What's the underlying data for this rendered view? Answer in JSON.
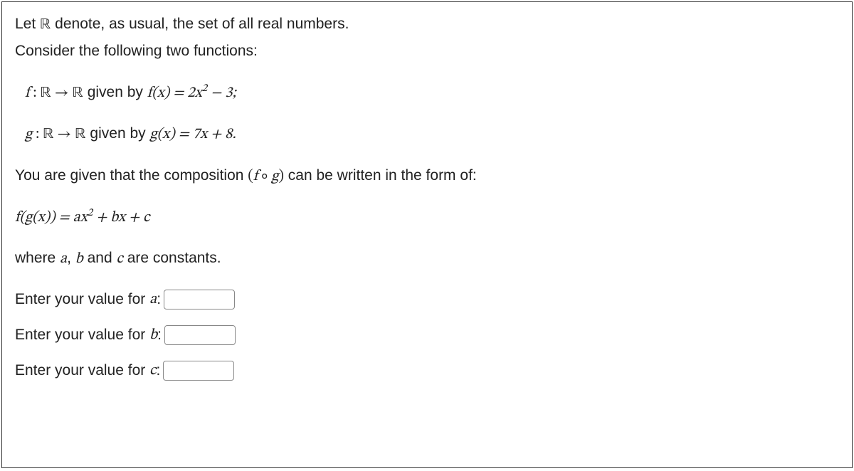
{
  "intro": {
    "line1_pre": "Let ",
    "line1_R": "ℝ",
    "line1_post": " denote, as usual, the set of all real numbers.",
    "line2": "Consider the following two functions:"
  },
  "func_f": {
    "lhs_f": "f",
    "colon": " : ",
    "R1": "ℝ",
    "arrow": " → ",
    "R2": "ℝ",
    "given": " given by ",
    "rhs_pre": "f(x) = 2x",
    "rhs_sup": "2",
    "rhs_post": " − 3;"
  },
  "func_g": {
    "lhs_g": "g",
    "colon": " : ",
    "R1": "ℝ",
    "arrow": " → ",
    "R2": "ℝ",
    "given": " given by ",
    "rhs": "g(x) = 7x + 8."
  },
  "comp": {
    "pre": "You are given that the composition ",
    "expr_open": "(",
    "f": "f",
    "circ": " ∘ ",
    "g": "g",
    "expr_close": ")",
    "post": " can be written in the form of:"
  },
  "form": {
    "lhs": "f(g(x)) = ax",
    "sup": "2",
    "rhs": " + bx + c"
  },
  "constants": {
    "pre": "where ",
    "a": "a",
    "sep1": ", ",
    "b": "b",
    "and": " and ",
    "c": "c",
    "post": " are constants."
  },
  "prompts": {
    "a_pre": "Enter your value for ",
    "a_var": "a",
    "a_colon": ":",
    "b_pre": "Enter your value for ",
    "b_var": "b",
    "b_colon": ":",
    "c_pre": "Enter your value for ",
    "c_var": "c",
    "c_colon": ":"
  }
}
